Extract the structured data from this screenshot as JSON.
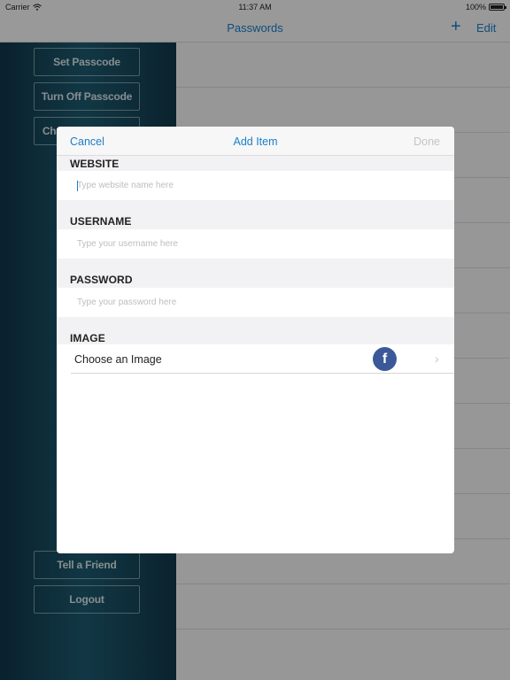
{
  "status": {
    "carrier": "Carrier",
    "time": "11:37 AM",
    "battery": "100%"
  },
  "nav": {
    "title": "Passwords",
    "add_icon": "plus-icon",
    "edit_label": "Edit"
  },
  "sidebar": {
    "buttons": [
      {
        "label": "Set Passcode"
      },
      {
        "label": "Turn Off Passcode"
      },
      {
        "label": "Change Passcode"
      },
      {
        "label": "Tell a Friend"
      },
      {
        "label": "Logout"
      }
    ]
  },
  "modal": {
    "cancel_label": "Cancel",
    "title": "Add Item",
    "done_label": "Done",
    "website": {
      "label": "WEBSITE",
      "placeholder": "Type website name here",
      "value": ""
    },
    "username": {
      "label": "USERNAME",
      "placeholder": "Type your username here",
      "value": ""
    },
    "password": {
      "label": "PASSWORD",
      "placeholder": "Type your password here",
      "value": ""
    },
    "image": {
      "label": "IMAGE",
      "row_label": "Choose an Image",
      "icon": "facebook-icon",
      "icon_glyph": "f"
    }
  },
  "colors": {
    "accent": "#1a7fc9",
    "facebook": "#3b5998",
    "sidebar": "#1d5a6f",
    "disabled": "#c4c4c4"
  }
}
